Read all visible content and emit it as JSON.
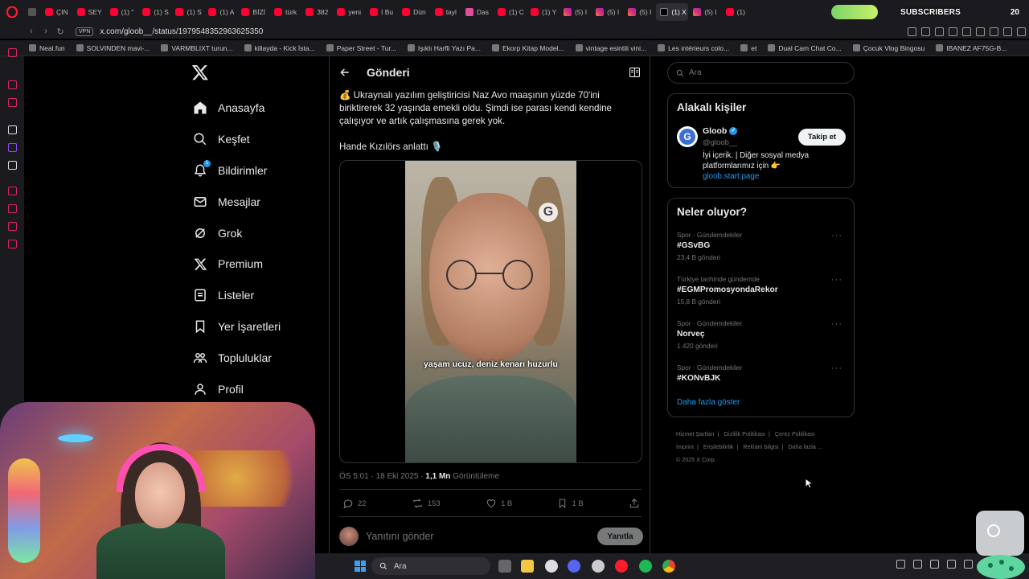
{
  "browser": {
    "tabs": [
      {
        "label": "ÇIN",
        "fav": "yt"
      },
      {
        "label": "SEY",
        "fav": "yt"
      },
      {
        "label": "(1) \"",
        "fav": "yt"
      },
      {
        "label": "(1) S",
        "fav": "yt"
      },
      {
        "label": "(1) S",
        "fav": "yt"
      },
      {
        "label": "(1) A",
        "fav": "yt"
      },
      {
        "label": "BİZİ",
        "fav": "yt"
      },
      {
        "label": "türk",
        "fav": "yt"
      },
      {
        "label": "382",
        "fav": "yt"
      },
      {
        "label": "yeni",
        "fav": "yt"
      },
      {
        "label": "I Bu",
        "fav": "yt"
      },
      {
        "label": "Dün",
        "fav": "yt"
      },
      {
        "label": "tayl",
        "fav": "yt"
      },
      {
        "label": "Das",
        "fav": "pink"
      },
      {
        "label": "(1) C",
        "fav": "yt"
      },
      {
        "label": "(1) Y",
        "fav": "yt"
      },
      {
        "label": "(5) I",
        "fav": "ig"
      },
      {
        "label": "(5) I",
        "fav": "ig"
      },
      {
        "label": "(5) I",
        "fav": "ig"
      },
      {
        "label": "(1) X",
        "fav": "x"
      },
      {
        "label": "(5) I",
        "fav": "ig"
      },
      {
        "label": "(1)",
        "fav": "yt"
      }
    ],
    "url": "x.com/gloob__/status/1979548352963625350",
    "vpn_label": "VPN",
    "bookmarks": [
      "Neal.fun",
      "SOLVINDEN mavi-...",
      "VARMBLIXT turun...",
      "killayda - Kick İsta...",
      "Paper Street - Tur...",
      "Işıklı Harfli Yazı Pa...",
      "Ekorp Kitap Model...",
      "vintage esintili vini...",
      "Les intérieurs colo...",
      "et",
      "Dual Cam Chat Co...",
      "Çocuk Vlog Bingosu",
      "IBANEZ AF75G-B..."
    ]
  },
  "subscriber_widget": {
    "label": "SUBSCRIBERS",
    "count": "20"
  },
  "nav": {
    "items": [
      {
        "label": "Anasayfa",
        "icon": "home-icon"
      },
      {
        "label": "Keşfet",
        "icon": "search-icon"
      },
      {
        "label": "Bildirimler",
        "icon": "bell-icon",
        "badge": "1"
      },
      {
        "label": "Mesajlar",
        "icon": "mail-icon"
      },
      {
        "label": "Grok",
        "icon": "grok-icon"
      },
      {
        "label": "Premium",
        "icon": "x-premium-icon"
      },
      {
        "label": "Listeler",
        "icon": "list-icon"
      },
      {
        "label": "Yer İşaretleri",
        "icon": "bookmark-icon"
      },
      {
        "label": "Topluluklar",
        "icon": "communities-icon"
      },
      {
        "label": "Profil",
        "icon": "profile-icon"
      }
    ]
  },
  "post": {
    "header_title": "Gönderi",
    "text": "💰 Ukraynalı yazılım geliştiricisi Naz Avo maaşının yüzde 70'ini biriktirerek 32 yaşında emekli oldu. Şimdi ise parası kendi kendine çalışıyor ve artık çalışmasına gerek yok.",
    "text2": "Hande Kızılörs anlattı 🎙️",
    "video_subtitle": "yaşam ucuz, deniz kenarı huzurlu",
    "video_logo": "G",
    "time": "ÖS 5:01 · 18 Eki 2025",
    "views_count": "1,1 Mn",
    "views_label": "Görüntüleme",
    "replies": "22",
    "reposts": "153",
    "likes": "1 B",
    "bookmarks": "1 B",
    "reply_placeholder": "Yanıtını gönder",
    "reply_button": "Yanıtla"
  },
  "right": {
    "search_placeholder": "Ara",
    "related_title": "Alakalı kişiler",
    "related_user": {
      "name": "Gloob",
      "handle": "@gloob__",
      "avatar_letter": "G",
      "bio": "İyi içerik. | Diğer sosyal medya platformlarımız için 👉",
      "bio_link": "gloob.start.page",
      "follow_label": "Takip et"
    },
    "trends_title": "Neler oluyor?",
    "trends": [
      {
        "context": "Spor · Gündemdekiler",
        "name": "#GSvBG",
        "count": "23,4 B gönderi"
      },
      {
        "context": "Türkiye tarihinde gündemde",
        "name": "#EGMPromosyondaRekor",
        "count": "15,8 B gönderi"
      },
      {
        "context": "Spor · Gündemdekiler",
        "name": "Norveç",
        "count": "1.420 gönderi"
      },
      {
        "context": "Spor · Gündemdekiler",
        "name": "#KONvBJK",
        "count": ""
      }
    ],
    "show_more": "Daha fazla göster",
    "footer": {
      "links1": [
        "Hizmet Şartları",
        "Gizlilik Politikası",
        "Çerez Politikası"
      ],
      "links2": [
        "İmprint",
        "Erişilebilirlik",
        "Reklam bilgisi",
        "Daha fazla ..."
      ],
      "copyright": "© 2025 X Corp."
    }
  },
  "taskbar": {
    "search_placeholder": "Ara"
  },
  "colors": {
    "accent": "#1d9bf0",
    "background": "#000000",
    "border": "#2f3336",
    "muted": "#71767b"
  }
}
